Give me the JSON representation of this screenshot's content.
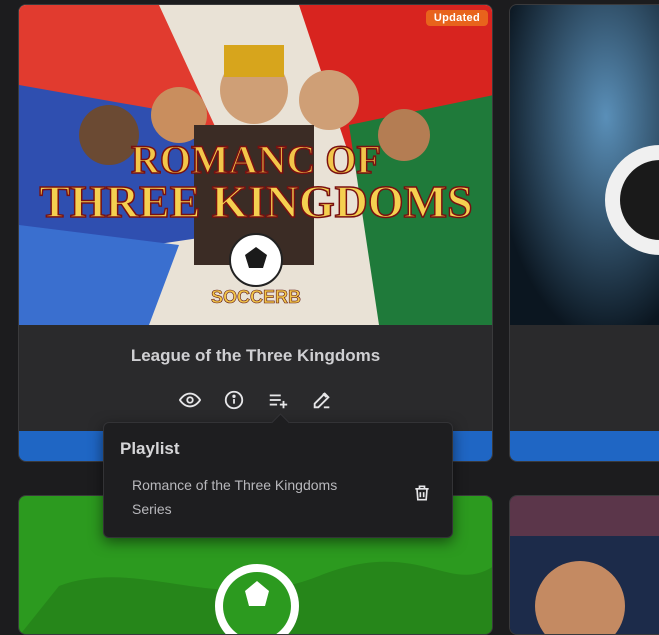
{
  "cards": [
    {
      "badge": "Updated",
      "art_text": {
        "line1": "ROMANC OF",
        "line2": "THREE KINGDOMS",
        "line3": "SOCCERB"
      },
      "title": "League of the Three Kingdoms",
      "actions": [
        "eye-icon",
        "info-icon",
        "playlist-add-icon",
        "edit-icon"
      ]
    }
  ],
  "popup": {
    "title": "Playlist",
    "items": [
      {
        "label": "Romance of the Three Kingdoms Series"
      }
    ]
  },
  "colors": {
    "background": "#1c1c1e",
    "card": "#2a2a2c",
    "badge": "#e8631c",
    "button": "#1f66c4"
  }
}
